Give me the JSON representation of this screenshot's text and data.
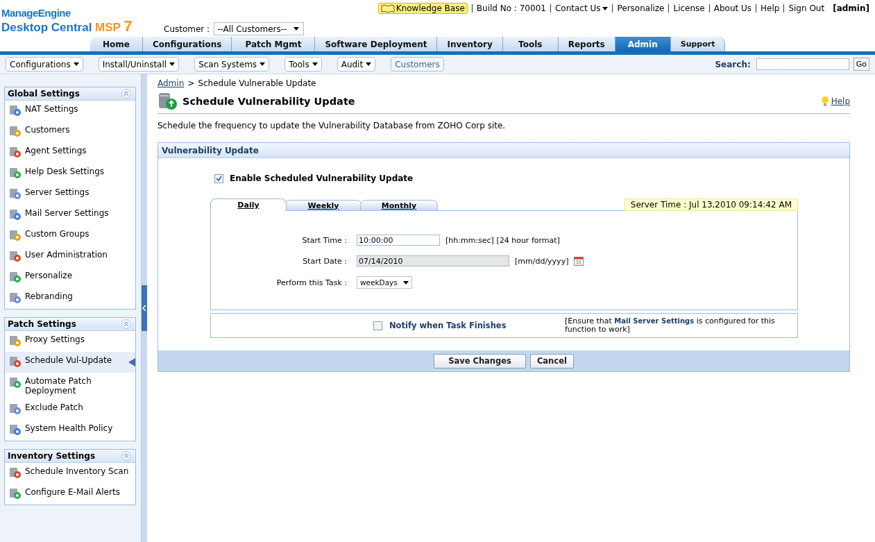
{
  "header": {
    "logo": {
      "brand": "ManageEngine",
      "product": "Desktop Central",
      "edition": "MSP",
      "version": "7"
    },
    "knowledge_base": "Knowledge Base",
    "top_links": [
      {
        "label": "Build No : 70001",
        "kind": "text"
      },
      {
        "label": "Contact Us",
        "kind": "dropdown"
      },
      {
        "label": "Personalize",
        "kind": "link"
      },
      {
        "label": "License",
        "kind": "link"
      },
      {
        "label": "About Us",
        "kind": "link"
      },
      {
        "label": "Help",
        "kind": "link"
      },
      {
        "label": "Sign Out",
        "kind": "link"
      }
    ],
    "user": "[admin]",
    "customer": {
      "label": "Customer :",
      "value": "--All Customers--"
    }
  },
  "tabs": [
    {
      "label": "Home",
      "selected": false
    },
    {
      "label": "Configurations",
      "selected": false
    },
    {
      "label": "Patch Mgmt",
      "selected": false
    },
    {
      "label": "Software Deployment",
      "selected": false
    },
    {
      "label": "Inventory",
      "selected": false
    },
    {
      "label": "Tools",
      "selected": false
    },
    {
      "label": "Reports",
      "selected": false
    },
    {
      "label": "Admin",
      "selected": true
    },
    {
      "label": "Support",
      "selected": false
    }
  ],
  "toolbar": {
    "menus": [
      {
        "label": "Configurations",
        "kind": "menu"
      },
      {
        "label": "Install/Uninstall",
        "kind": "menu"
      },
      {
        "label": "Scan Systems",
        "kind": "menu"
      },
      {
        "label": "Tools",
        "kind": "menu"
      },
      {
        "label": "Audit",
        "kind": "menu"
      },
      {
        "label": "Customers",
        "kind": "button"
      }
    ],
    "search": {
      "label": "Search:",
      "button": "Go"
    }
  },
  "sidebar": {
    "sections": [
      {
        "title": "Global Settings",
        "items": [
          {
            "label": "NAT Settings",
            "selected": false
          },
          {
            "label": "Customers",
            "selected": false
          },
          {
            "label": "Agent Settings",
            "selected": false
          },
          {
            "label": "Help Desk Settings",
            "selected": false
          },
          {
            "label": "Server Settings",
            "selected": false
          },
          {
            "label": "Mail Server Settings",
            "selected": false
          },
          {
            "label": "Custom Groups",
            "selected": false
          },
          {
            "label": "User Administration",
            "selected": false
          },
          {
            "label": "Personalize",
            "selected": false
          },
          {
            "label": "Rebranding",
            "selected": false
          }
        ]
      },
      {
        "title": "Patch Settings",
        "items": [
          {
            "label": "Proxy Settings",
            "selected": false
          },
          {
            "label": "Schedule Vul-Update",
            "selected": true
          },
          {
            "label": "Automate Patch Deployment",
            "selected": false
          },
          {
            "label": "Exclude Patch",
            "selected": false
          },
          {
            "label": "System Health Policy",
            "selected": false
          }
        ]
      },
      {
        "title": "Inventory Settings",
        "items": [
          {
            "label": "Schedule Inventory Scan",
            "selected": false
          },
          {
            "label": "Configure E-Mail Alerts",
            "selected": false
          }
        ]
      }
    ]
  },
  "breadcrumb": {
    "link": "Admin",
    "separator": ">",
    "current": "Schedule Vulnerable Update"
  },
  "page_title": "Schedule Vulnerability Update",
  "help_link": "Help",
  "description": "Schedule the frequency to update the Vulnerability Database from ZOHO Corp site.",
  "panel": {
    "title": "Vulnerability Update",
    "enable": {
      "label": "Enable Scheduled Vulnerability Update",
      "checked": true
    },
    "schedule_tabs": [
      {
        "label": "Daily",
        "selected": true
      },
      {
        "label": "Weekly",
        "selected": false
      },
      {
        "label": "Monthly",
        "selected": false
      }
    ],
    "server_time": "Server Time : Jul 13,2010 09:14:42 AM",
    "fields": [
      {
        "label": "Start Time :",
        "kind": "text",
        "value": "10:00:00",
        "hint": "[hh:mm:sec] [24 hour format]"
      },
      {
        "label": "Start Date :",
        "kind": "date",
        "value": "07/14/2010",
        "hint": "[mm/dd/yyyy]"
      },
      {
        "label": "Perform this Task :",
        "kind": "select",
        "value": "weekDays"
      }
    ],
    "notify": {
      "label": "Notify when Task Finishes",
      "checked": false,
      "note": "[Ensure that **Mail Server Settings** is configured for this function to work]"
    },
    "buttons": [
      "Save Changes",
      "Cancel"
    ]
  }
}
